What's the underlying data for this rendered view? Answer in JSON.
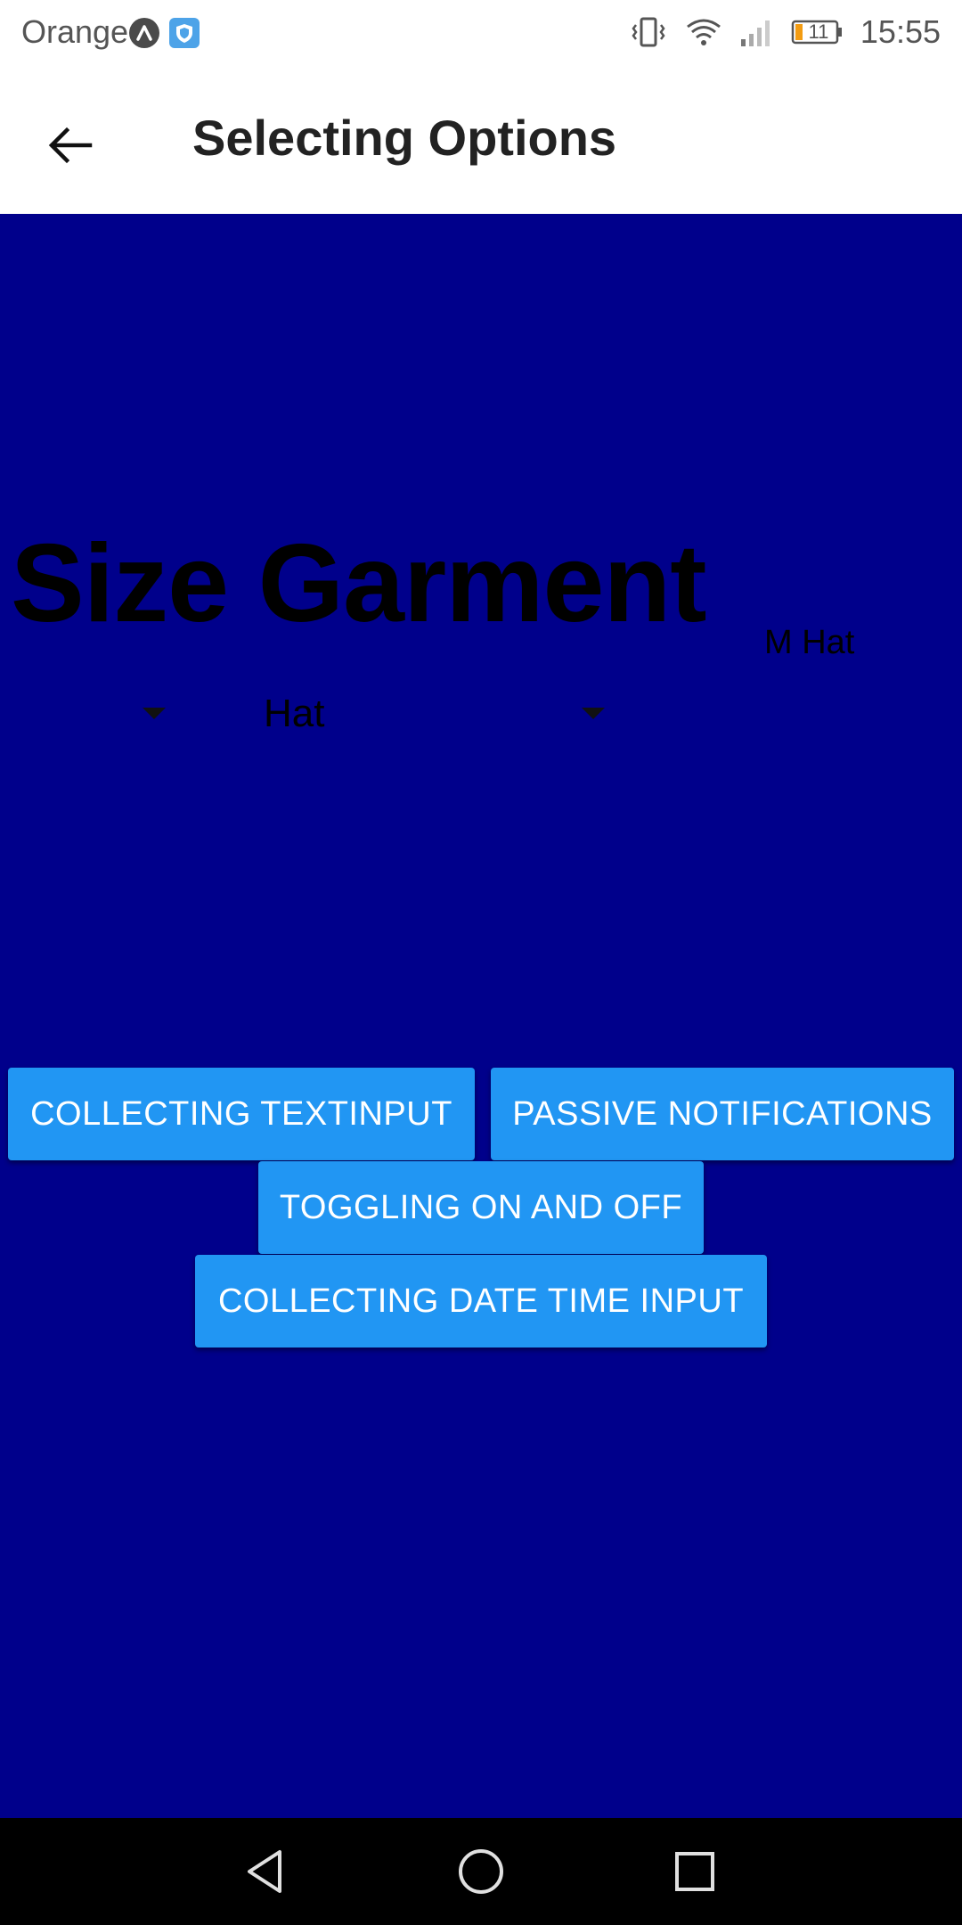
{
  "status_bar": {
    "carrier": "Orange",
    "battery": "11",
    "time": "15:55"
  },
  "app_bar": {
    "title": "Selecting Options"
  },
  "main": {
    "heading": "Size Garment",
    "picker_garment_value": "Hat",
    "selection_summary": "M Hat",
    "buttons": [
      {
        "label": "COLLECTING TEXTINPUT"
      },
      {
        "label": "PASSIVE NOTIFICATIONS"
      },
      {
        "label": "TOGGLING ON AND OFF"
      },
      {
        "label": "COLLECTING DATE TIME INPUT"
      }
    ]
  },
  "colors": {
    "content_background": "#00008b",
    "button": "#2196f3",
    "button_text": "#ffffff"
  },
  "icons": {
    "back": "arrow-left-icon",
    "nav_back": "triangle-back-icon",
    "nav_home": "circle-home-icon",
    "nav_recents": "square-recents-icon"
  }
}
